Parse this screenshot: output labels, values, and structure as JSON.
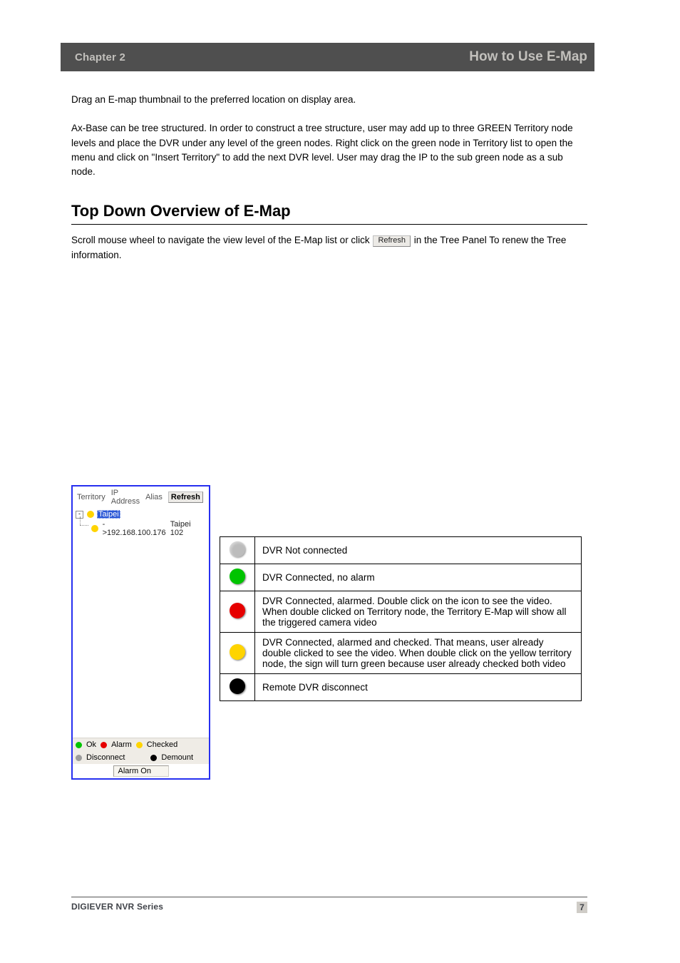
{
  "header": {
    "chapter_label": "Chapter 2",
    "chapter_title": "How to Use E-Map"
  },
  "body": {
    "drag_instruction": "Drag an E-map thumbnail to the preferred location on display area.",
    "axbase_instruction": "Ax-Base can be tree structured. In order to construct a tree structure, user may add up to three GREEN Territory node levels and place the DVR under any level of the green nodes. Right click on the green node in Territory list to open the menu and click on \"Insert Territory\" to add the next DVR level. User may drag the IP to the sub green node as a sub node.",
    "heading_overview": "Top Down Overview of E-Map",
    "overview_body_pre": "Scroll mouse wheel to navigate the view level of the E-Map list or click ",
    "overview_body_post": " in the Tree Panel To renew the Tree information."
  },
  "refresh_button_label": "Refresh",
  "tree_panel": {
    "tabs": {
      "territory": "Territory",
      "ip_address": "IP Address",
      "alias": "Alias"
    },
    "refresh_label": "Refresh",
    "root": {
      "label": "Taipei"
    },
    "child": {
      "ip": "->192.168.100.176",
      "alias": "Taipei 102"
    },
    "legend": {
      "ok": "Ok",
      "alarm": "Alarm",
      "checked": "Checked",
      "disconnect": "Disconnect",
      "demount": "Demount"
    },
    "status_text": "Alarm On"
  },
  "dot_table": {
    "rows": [
      {
        "color": "grey",
        "text": "DVR Not connected"
      },
      {
        "color": "green",
        "text": "DVR Connected, no alarm"
      },
      {
        "color": "red",
        "text": "DVR Connected, alarmed. Double click on the icon to see the video. When double clicked on Territory node, the Territory E-Map will show all the triggered camera video"
      },
      {
        "color": "yellow",
        "text": "DVR Connected, alarmed and checked. That means, user already double clicked to see the video. When double click on the yellow territory node, the sign will turn green because user already checked both video"
      },
      {
        "color": "black",
        "text": "Remote DVR disconnect"
      }
    ]
  },
  "footer": {
    "product": "DIGIEVER NVR Series",
    "page": "7"
  },
  "colors": {
    "green": "#00c400",
    "red": "#e60000",
    "yellow": "#ffd400",
    "grey": "#9c9c9c",
    "black": "#000000"
  }
}
